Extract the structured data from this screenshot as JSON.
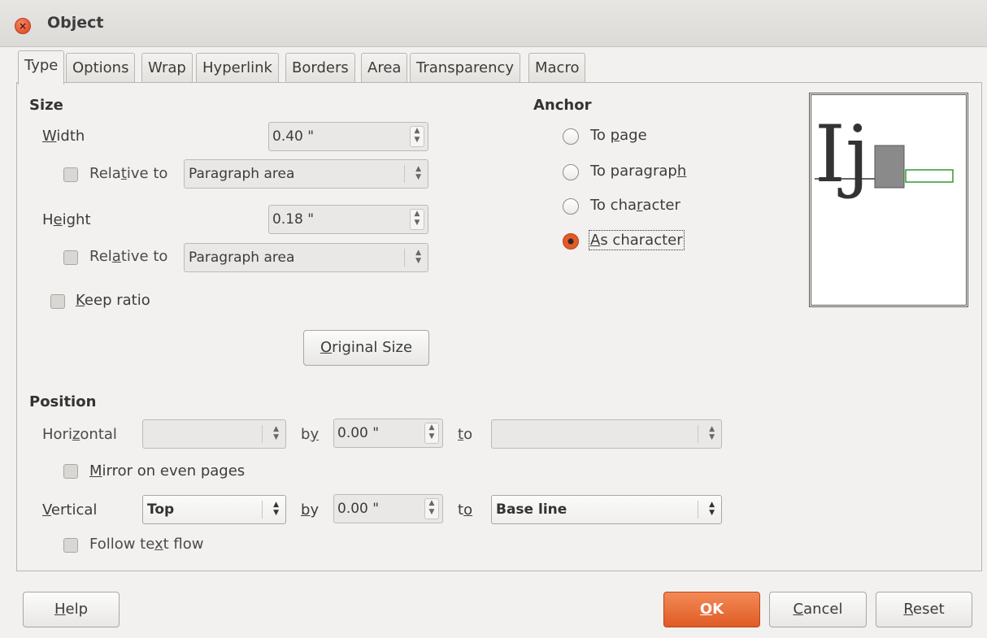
{
  "window": {
    "title": "Object"
  },
  "tabs": [
    {
      "label": "Type",
      "active": true
    },
    {
      "label": "Options"
    },
    {
      "label": "Wrap"
    },
    {
      "label": "Hyperlink"
    },
    {
      "label": "Borders"
    },
    {
      "label": "Area"
    },
    {
      "label": "Transparency"
    },
    {
      "label": "Macro"
    }
  ],
  "size": {
    "title": "Size",
    "width_label": "Width",
    "width_value": "0.40 \"",
    "width_relative_label": "Relative to",
    "width_relative_value": "Paragraph area",
    "height_label": "Height",
    "height_value": "0.18 \"",
    "height_relative_label": "Relative to",
    "height_relative_value": "Paragraph area",
    "keep_ratio_label": "Keep ratio",
    "original_size_label": "Original Size"
  },
  "anchor": {
    "title": "Anchor",
    "options": [
      "To page",
      "To paragraph",
      "To character",
      "As character"
    ],
    "selected": "As character"
  },
  "preview": {
    "glyphs": "Ij"
  },
  "position": {
    "title": "Position",
    "horizontal_label": "Horizontal",
    "horizontal_value": "",
    "by_label": "by",
    "horizontal_by_value": "0.00 \"",
    "to_label": "to",
    "horizontal_to_value": "",
    "mirror_label": "Mirror on even pages",
    "vertical_label": "Vertical",
    "vertical_value": "Top",
    "vertical_by_value": "0.00 \"",
    "vertical_to_value": "Base line",
    "follow_text_flow_label": "Follow text flow"
  },
  "footer": {
    "help_label": "Help",
    "ok_label": "OK",
    "cancel_label": "Cancel",
    "reset_label": "Reset"
  },
  "colors": {
    "accent": "#e05b25",
    "close_button": "#e2532e",
    "preview_object": "#8a8a8a",
    "preview_frame_marker": "#2e9b2e"
  }
}
